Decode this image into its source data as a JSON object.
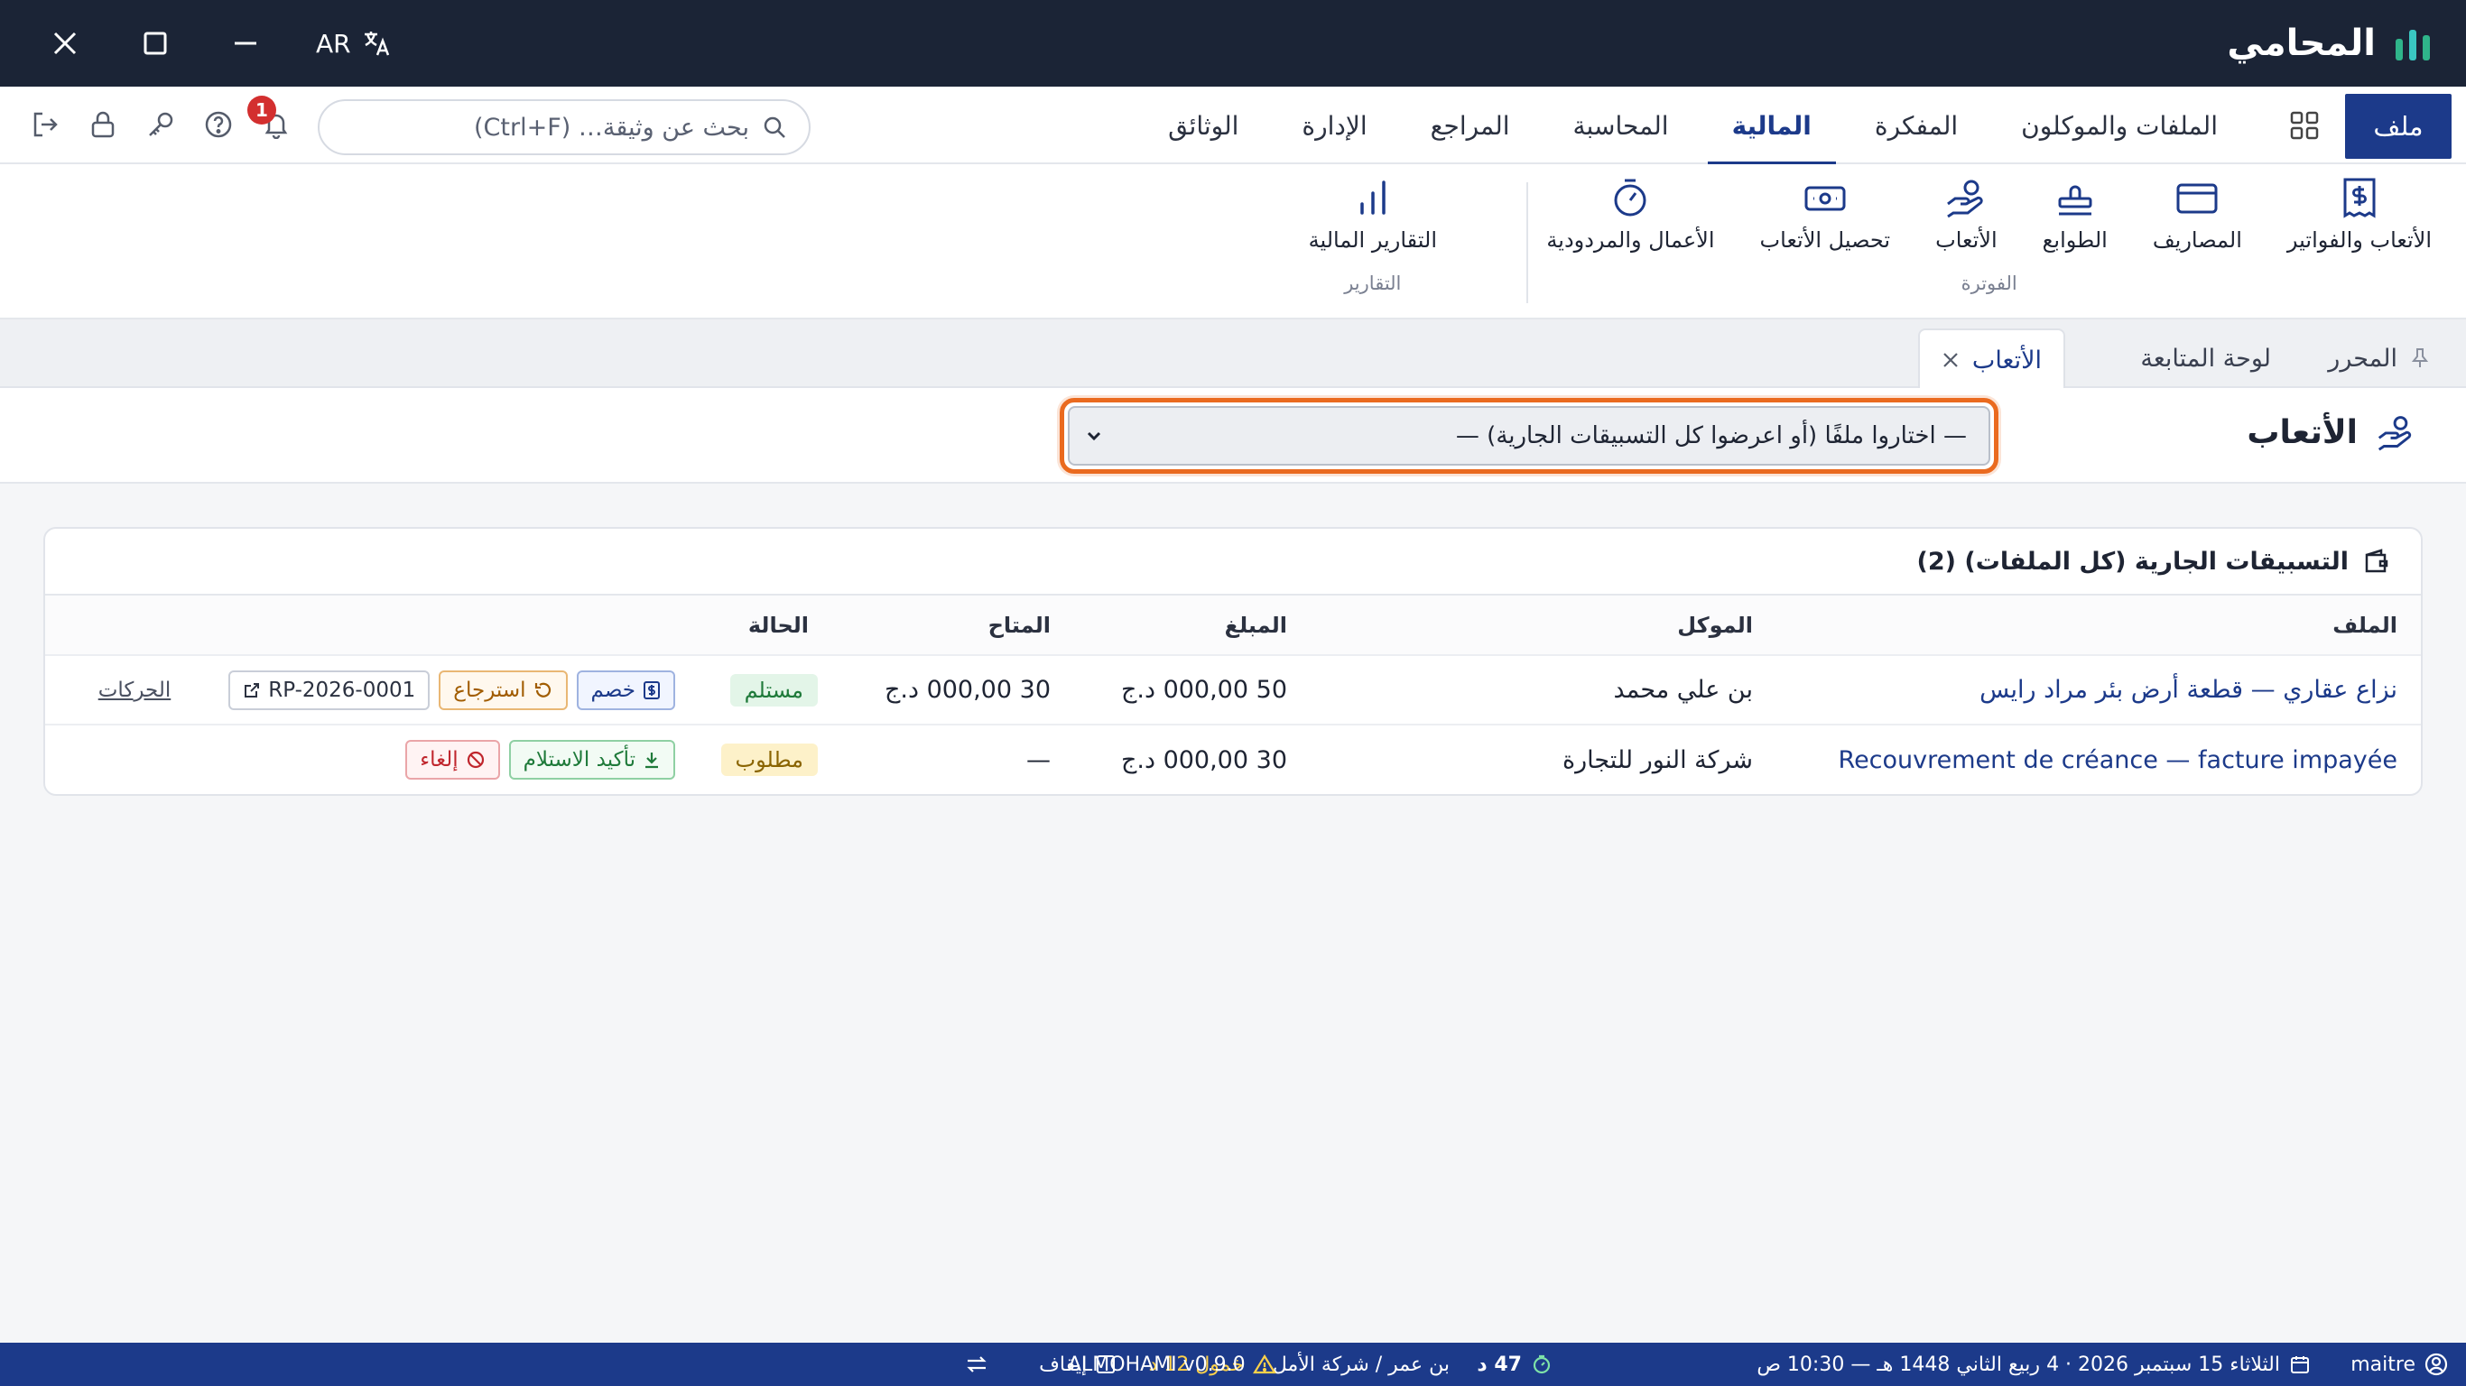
{
  "app": {
    "name": "المحامي",
    "lang_code": "AR"
  },
  "menu": {
    "file_label": "ملف",
    "tabs": [
      {
        "label": "الملفات والموكلون",
        "active": false
      },
      {
        "label": "المفكرة",
        "active": false
      },
      {
        "label": "المالية",
        "active": true
      },
      {
        "label": "المحاسبة",
        "active": false
      },
      {
        "label": "المراجع",
        "active": false
      },
      {
        "label": "الإدارة",
        "active": false
      },
      {
        "label": "الوثائق",
        "active": false
      }
    ],
    "search_placeholder": "بحث عن وثيقة… (Ctrl+F)",
    "notifications_count": "1"
  },
  "ribbon": {
    "billing_group": {
      "label": "الفوترة",
      "items": [
        {
          "label": "الأتعاب والفواتير",
          "icon": "invoice-dollar-icon"
        },
        {
          "label": "المصاريف",
          "icon": "credit-card-icon"
        },
        {
          "label": "الطوابع",
          "icon": "stamp-icon"
        },
        {
          "label": "الأتعاب",
          "icon": "hand-coins-icon"
        },
        {
          "label": "تحصيل الأتعاب",
          "icon": "banknote-icon"
        },
        {
          "label": "الأعمال والمردودية",
          "icon": "timer-icon"
        }
      ]
    },
    "reports_group": {
      "label": "التقارير",
      "items": [
        {
          "label": "التقارير المالية",
          "icon": "bar-chart-icon"
        }
      ]
    }
  },
  "doc_tabs": [
    {
      "label": "المحرر",
      "pinned": true
    },
    {
      "label": "لوحة المتابعة"
    },
    {
      "label": "الأتعاب",
      "active": true,
      "closable": true
    }
  ],
  "page": {
    "title": "الأتعاب",
    "file_select_value": "— اختاروا ملفًا (أو اعرضوا كل التسبيقات الجارية) —"
  },
  "advances": {
    "title": "التسبيقات الجارية (كل الملفات) (2)",
    "columns": {
      "file": "الملف",
      "client": "الموكل",
      "amount": "المبلغ",
      "available": "المتاح",
      "status": "الحالة"
    },
    "rows": [
      {
        "file": "نزاع عقاري — قطعة أرض بئر مراد رايس",
        "client": "بن علي محمد",
        "amount": "50 000,00 د.ج",
        "available": "30 000,00 د.ج",
        "status": "مستلم",
        "status_kind": "ok",
        "actions": {
          "deduct": "خصم",
          "refund": "استرجاع",
          "receipt_ref": "RP-2026-0001",
          "movements": "الحركات"
        }
      },
      {
        "file": "Recouvrement de créance — facture impayée",
        "client": "شركة النور للتجارة",
        "amount": "30 000,00 د.ج",
        "available": "—",
        "status": "مطلوب",
        "status_kind": "due",
        "actions": {
          "confirm": "تأكيد الاستلام",
          "cancel": "إلغاء"
        }
      }
    ]
  },
  "statusbar": {
    "user": "maitre",
    "date": "الثلاثاء 15 سبتمبر 2026 · 4 ربيع الثاني 1448 هـ — 10:30 ص",
    "timer": "47 د",
    "context": "بن عمر / شركة الأمل",
    "warning": "خمول 12 د",
    "pause": "إيقاف",
    "version": "ALMOHAMI v0.9.0"
  },
  "colors": {
    "titlebar": "#1b2436",
    "primary": "#1c3a8a",
    "focus_ring": "#ea6a1f",
    "status_ok": "#1f7a3a",
    "status_due": "#8a6400"
  }
}
